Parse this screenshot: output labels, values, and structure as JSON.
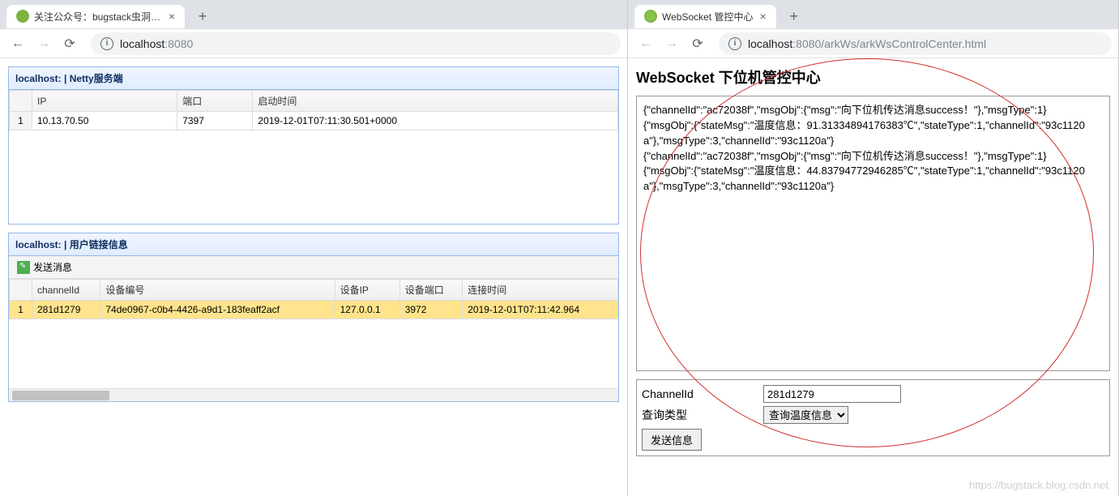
{
  "left": {
    "tab_title": "关注公众号：bugstack虫洞栈 | ",
    "url_host": "localhost",
    "url_path": ":8080",
    "panel1": {
      "title": "localhost: | Netty服务端",
      "columns": [
        "",
        "IP",
        "端口",
        "启动时间"
      ],
      "row": {
        "idx": "1",
        "ip": "10.13.70.50",
        "port": "7397",
        "time": "2019-12-01T07:11:30.501+0000"
      }
    },
    "panel2": {
      "title": "localhost: | 用户链接信息",
      "toolbar_send": "发送消息",
      "columns": [
        "",
        "channelId",
        "设备编号",
        "设备IP",
        "设备端口",
        "连接时间"
      ],
      "row": {
        "idx": "1",
        "channelId": "281d1279",
        "deviceNo": "74de0967-c0b4-4426-a9d1-183feaff2acf",
        "deviceIp": "127.0.0.1",
        "devicePort": "3972",
        "connTime": "2019-12-01T07:11:42.964"
      }
    }
  },
  "right": {
    "tab_title": "WebSocket 管控中心",
    "url_host": "localhost",
    "url_path": ":8080/arkWs/arkWsControlCenter.html",
    "page_title": "WebSocket 下位机管控中心",
    "log_lines": [
      "{\"channelId\":\"ac72038f\",\"msgObj\":{\"msg\":\"向下位机传达消息success！\"},\"msgType\":1}",
      "{\"msgObj\":{\"stateMsg\":\"温度信息：91.31334894176383℃\",\"stateType\":1,\"channelId\":\"93c1120a\"},\"msgType\":3,\"channelId\":\"93c1120a\"}",
      "{\"channelId\":\"ac72038f\",\"msgObj\":{\"msg\":\"向下位机传达消息success！\"},\"msgType\":1}",
      "{\"msgObj\":{\"stateMsg\":\"温度信息：44.83794772946285℃\",\"stateType\":1,\"channelId\":\"93c1120a\"},\"msgType\":3,\"channelId\":\"93c1120a\"}"
    ],
    "form": {
      "channel_label": "ChannelId",
      "channel_value": "281d1279",
      "type_label": "查询类型",
      "type_value": "查询温度信息",
      "submit_label": "发送信息"
    },
    "watermark": "https://bugstack.blog.csdn.net"
  },
  "icons": {
    "close": "×",
    "plus": "+",
    "back": "←",
    "forward": "→",
    "reload": "⟳",
    "info": "i",
    "dropdown": "▼"
  }
}
